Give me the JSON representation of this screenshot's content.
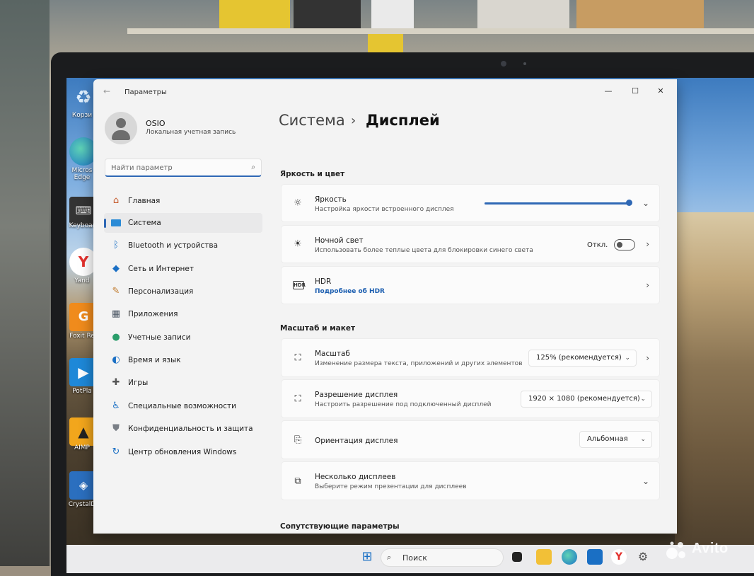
{
  "window": {
    "title": "Параметры"
  },
  "user": {
    "name": "OSIO",
    "account_type": "Локальная учетная запись"
  },
  "search": {
    "placeholder": "Найти параметр"
  },
  "sidebar": {
    "items": [
      {
        "label": "Главная",
        "icon": "home-icon",
        "active": false
      },
      {
        "label": "Система",
        "icon": "system-icon",
        "active": true
      },
      {
        "label": "Bluetooth и устройства",
        "icon": "bluetooth-icon",
        "active": false
      },
      {
        "label": "Сеть и Интернет",
        "icon": "wifi-icon",
        "active": false
      },
      {
        "label": "Персонализация",
        "icon": "brush-icon",
        "active": false
      },
      {
        "label": "Приложения",
        "icon": "apps-icon",
        "active": false
      },
      {
        "label": "Учетные записи",
        "icon": "account-icon",
        "active": false
      },
      {
        "label": "Время и язык",
        "icon": "globe-icon",
        "active": false
      },
      {
        "label": "Игры",
        "icon": "gamepad-icon",
        "active": false
      },
      {
        "label": "Специальные возможности",
        "icon": "accessibility-icon",
        "active": false
      },
      {
        "label": "Конфиденциальность и защита",
        "icon": "shield-icon",
        "active": false
      },
      {
        "label": "Центр обновления Windows",
        "icon": "update-icon",
        "active": false
      }
    ]
  },
  "breadcrumb": {
    "parent": "Система",
    "separator": "›",
    "current": "Дисплей"
  },
  "sections": {
    "brightness_color": "Яркость и цвет",
    "scale_layout": "Масштаб и макет",
    "related": "Сопутствующие параметры"
  },
  "brightness": {
    "title": "Яркость",
    "subtitle": "Настройка яркости встроенного дисплея",
    "level": 0.98
  },
  "night_light": {
    "title": "Ночной свет",
    "subtitle": "Использовать более теплые цвета для блокировки синего света",
    "state": "Откл."
  },
  "hdr": {
    "title": "HDR",
    "link": "Подробнее об HDR"
  },
  "scale": {
    "title": "Масштаб",
    "subtitle": "Изменение размера текста, приложений и других элементов",
    "value": "125% (рекомендуется)"
  },
  "resolution": {
    "title": "Разрешение дисплея",
    "subtitle": "Настроить разрешение под подключенный дисплей",
    "value": "1920 × 1080 (рекомендуется)"
  },
  "orientation": {
    "title": "Ориентация дисплея",
    "value": "Альбомная"
  },
  "multiple_displays": {
    "title": "Несколько дисплеев",
    "subtitle": "Выберите режим презентации для дисплеев"
  },
  "taskbar": {
    "search_label": "Поиск"
  },
  "desktop": {
    "icons": [
      {
        "label": "Корзи"
      },
      {
        "label": "Micros Edge"
      },
      {
        "label": "Keyboar"
      },
      {
        "label": "Yand"
      },
      {
        "label": "Foxit Re"
      },
      {
        "label": "PotPla"
      },
      {
        "label": "AIMP"
      },
      {
        "label": "CrystalD"
      }
    ]
  },
  "watermark": {
    "text": "Avito"
  },
  "colors": {
    "accent": "#2f68b5",
    "window_bg": "#f3f3f3",
    "card_bg": "#fbfbfb"
  }
}
